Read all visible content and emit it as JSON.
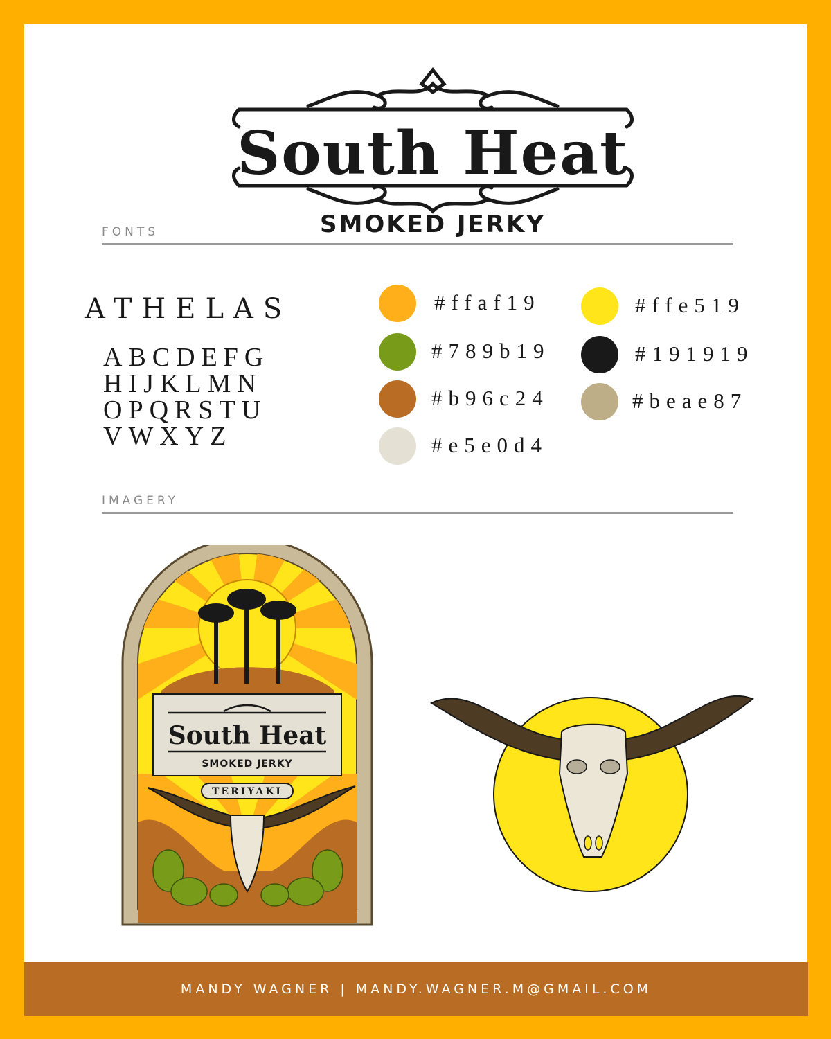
{
  "brand": {
    "name": "South Heat",
    "tagline": "SMOKED JERKY",
    "flavor": "TERIYAKI"
  },
  "sections": {
    "fonts_label": "FONTS",
    "imagery_label": "IMAGERY"
  },
  "font_sample": {
    "font_name": "ATHELAS",
    "lines": [
      "ABCDEFG",
      "HIJKLMN",
      "OPQRSTU",
      "VWXYZ"
    ]
  },
  "palette": [
    {
      "label": "#ffaf19",
      "color": "#ffaf19"
    },
    {
      "label": "#789b19",
      "color": "#789b19"
    },
    {
      "label": "#b96c24",
      "color": "#b96c24"
    },
    {
      "label": "#e5e0d4",
      "color": "#e5e0d4"
    },
    {
      "label": "#ffe519",
      "color": "#ffe519"
    },
    {
      "label": "#191919",
      "color": "#191919"
    },
    {
      "label": "#beae87",
      "color": "#beae87"
    }
  ],
  "footer": {
    "text": "MANDY WAGNER | MANDY.WAGNER.M@GMAIL.COM"
  },
  "colors": {
    "frame": "#ffaf00",
    "footer_bg": "#b96c24"
  }
}
